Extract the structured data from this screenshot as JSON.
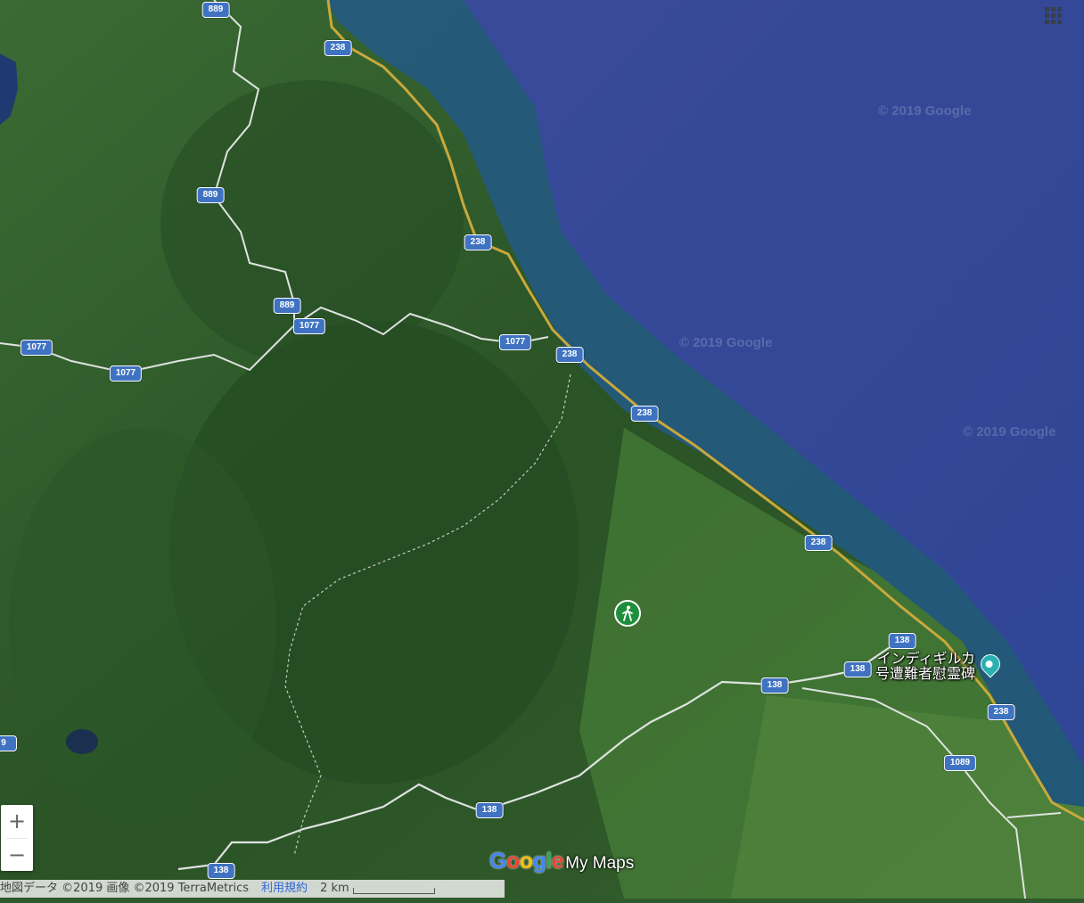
{
  "map": {
    "type": "satellite",
    "watermarks": [
      "© 2019 Google",
      "© 2019 Google",
      "© 2019 Google"
    ],
    "road_shields": [
      {
        "route": "889"
      },
      {
        "route": "889"
      },
      {
        "route": "889"
      },
      {
        "route": "1077"
      },
      {
        "route": "1077"
      },
      {
        "route": "1077"
      },
      {
        "route": "1077"
      },
      {
        "route": "238"
      },
      {
        "route": "238"
      },
      {
        "route": "238"
      },
      {
        "route": "238"
      },
      {
        "route": "238"
      },
      {
        "route": "238"
      },
      {
        "route": "138"
      },
      {
        "route": "138"
      },
      {
        "route": "138"
      },
      {
        "route": "138"
      },
      {
        "route": "138"
      },
      {
        "route": "1089"
      },
      {
        "route": "9"
      }
    ],
    "poi": {
      "label_line1": "インディギルカ",
      "label_line2": "号遭難者慰霊碑",
      "icon": "landmark-pin-icon"
    },
    "hiking_marker": {
      "icon": "hiker-icon",
      "color": "#1d8f3a"
    }
  },
  "controls": {
    "zoom_in": "+",
    "zoom_out": "−",
    "apps_icon": "grid-icon"
  },
  "branding": {
    "google": "Google",
    "product": "My Maps"
  },
  "footer": {
    "attribution": "地図データ ©2019 画像 ©2019 TerraMetrics",
    "terms": "利用規約",
    "scale": "2 km"
  },
  "colors": {
    "sea": "#3a4f9e",
    "land": "#2f5a2c",
    "road_shield": "#3f73c2",
    "poi_pin": "#2ab0b0"
  }
}
